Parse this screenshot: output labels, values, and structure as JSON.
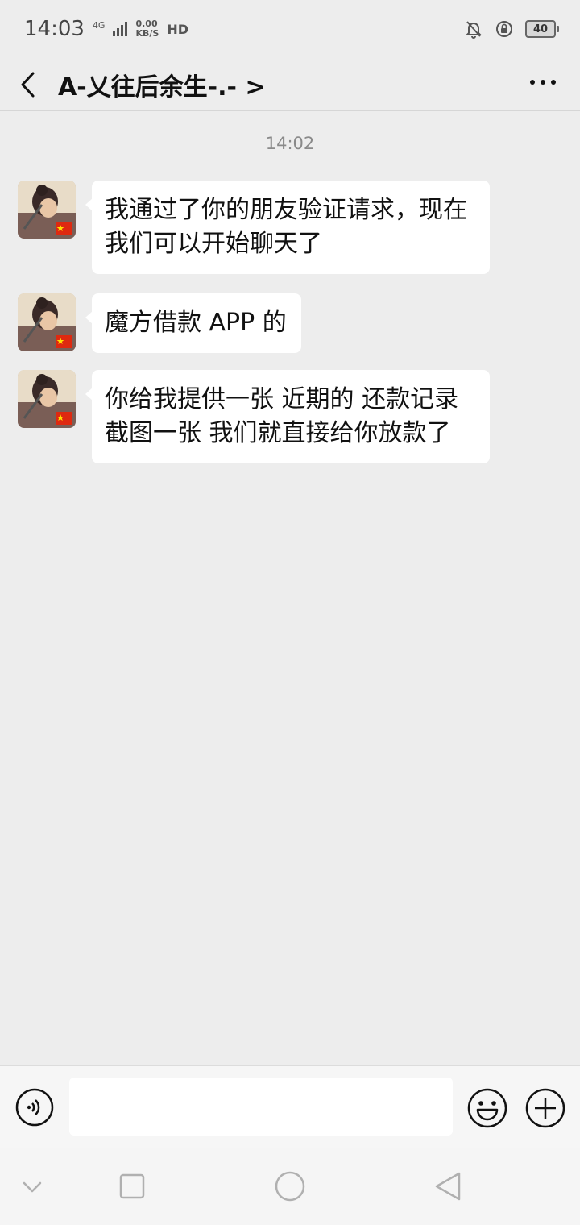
{
  "status_bar": {
    "time": "14:03",
    "network_type": "4G",
    "net_speed_value": "0.00",
    "net_speed_unit": "KB/S",
    "hd_label": "HD",
    "battery": "40"
  },
  "header": {
    "title": "A-乂往后余生-.- >"
  },
  "chat": {
    "timestamp": "14:02",
    "messages": [
      {
        "text": "我通过了你的朋友验证请求，现在我们可以开始聊天了"
      },
      {
        "text": "魔方借款 APP 的"
      },
      {
        "text": "你给我提供一张 近期的 还款记录截图一张 我们就直接给你放款了"
      }
    ]
  },
  "input_bar": {
    "text_value": "",
    "placeholder": ""
  },
  "colors": {
    "background": "#ededed",
    "bubble": "#ffffff",
    "text": "#111111",
    "timestamp": "#8a8a8a"
  }
}
